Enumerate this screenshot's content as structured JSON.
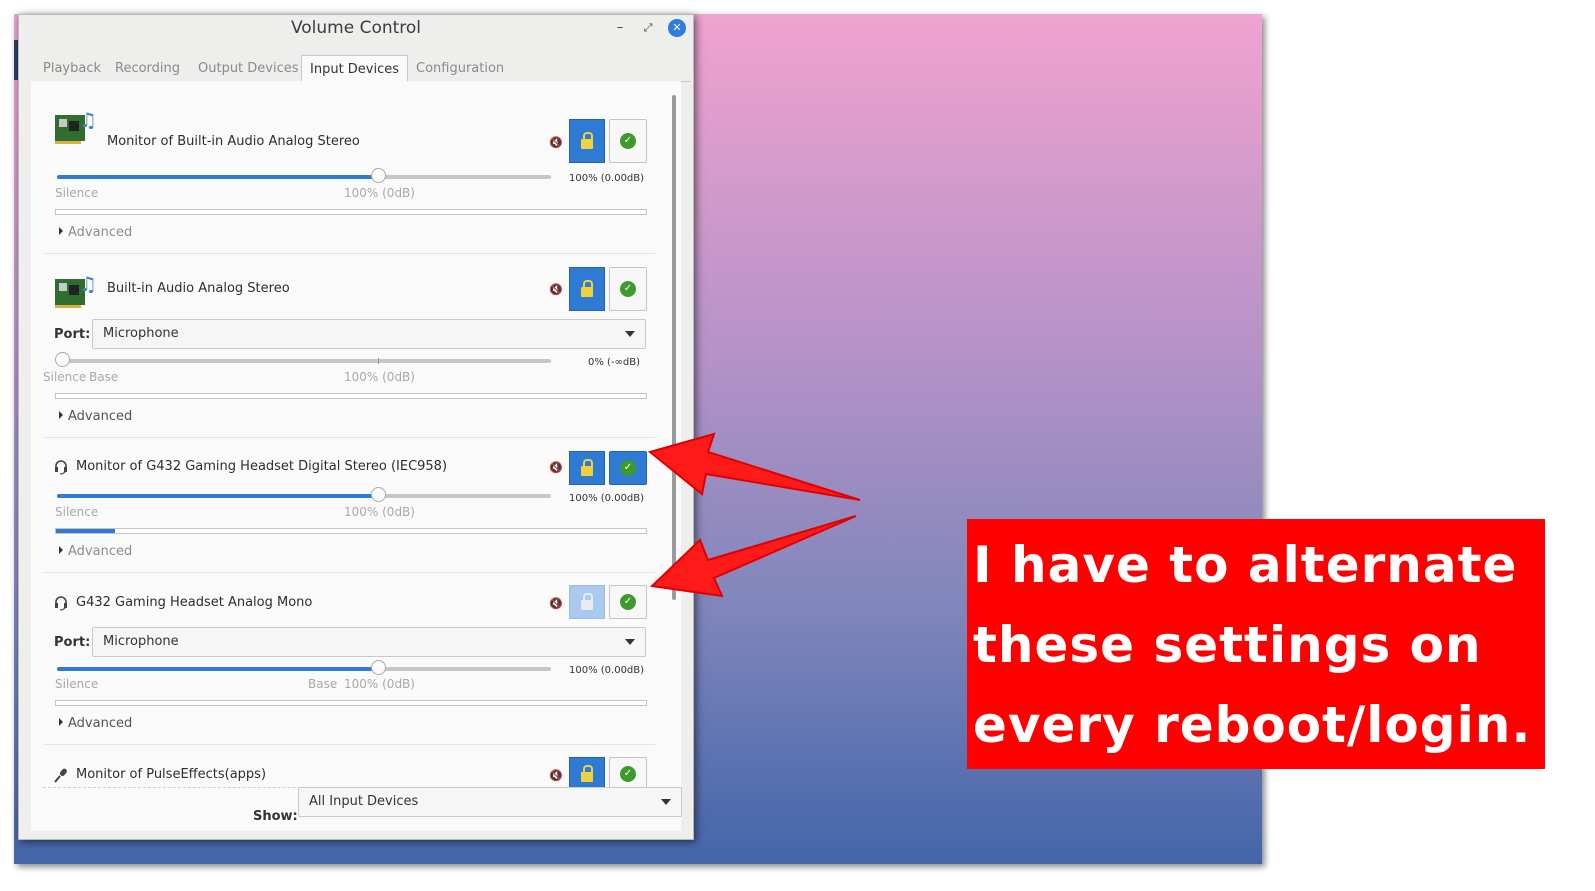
{
  "window": {
    "title": "Volume Control",
    "minimize_glyph": "–",
    "maximize_glyph": "⤢",
    "close_glyph": "✕"
  },
  "tabs": [
    {
      "label": "Playback",
      "active": false
    },
    {
      "label": "Recording",
      "active": false
    },
    {
      "label": "Output Devices",
      "active": false
    },
    {
      "label": "Input Devices",
      "active": true
    },
    {
      "label": "Configuration",
      "active": false
    }
  ],
  "devices": [
    {
      "name": "Monitor of Built-in Audio Analog Stereo",
      "icon": "sound-card-icon",
      "volume_text": "100% (0.00dB)",
      "volume_fraction": 0.65,
      "scale_silence": "Silence",
      "scale_100": "100% (0dB)",
      "meter_fraction": 0.0,
      "advanced": "Advanced",
      "lock_active": true,
      "default_active": false
    },
    {
      "name": "Built-in Audio Analog Stereo",
      "icon": "sound-card-icon",
      "port_label": "Port:",
      "port_value": "Microphone",
      "volume_text": "0% (-∞dB)",
      "volume_fraction": 0.0,
      "scale_silence": "Silence",
      "scale_base": "Base",
      "scale_100": "100% (0dB)",
      "meter_fraction": 0.0,
      "advanced": "Advanced",
      "lock_active": true,
      "default_active": false
    },
    {
      "name": "Monitor of G432 Gaming Headset Digital Stereo (IEC958)",
      "icon": "headset-icon",
      "volume_text": "100% (0.00dB)",
      "volume_fraction": 0.65,
      "scale_silence": "Silence",
      "scale_100": "100% (0dB)",
      "meter_fraction": 0.1,
      "advanced": "Advanced",
      "lock_active": true,
      "default_active": true
    },
    {
      "name": "G432 Gaming Headset Analog Mono",
      "icon": "headset-icon",
      "port_label": "Port:",
      "port_value": "Microphone",
      "volume_text": "100% (0.00dB)",
      "volume_fraction": 0.65,
      "scale_silence": "Silence",
      "scale_base": "Base",
      "scale_100": "100% (0dB)",
      "meter_fraction": 0.0,
      "advanced": "Advanced",
      "lock_active": false,
      "default_active": false
    },
    {
      "name": "Monitor of PulseEffects(apps)",
      "icon": "microphone-icon",
      "lock_active": true,
      "default_active": false
    }
  ],
  "footer": {
    "show_label": "Show:",
    "show_value": "All Input Devices"
  },
  "annotation": {
    "lines": [
      "I have to alternate",
      "these settings on",
      "every reboot/login."
    ],
    "background_color": "#ff0000",
    "text_color": "#ffffff"
  },
  "colors": {
    "accent": "#2f7ad3",
    "check_green": "#3f9a2e",
    "lock_yellow": "#f2d23c"
  }
}
